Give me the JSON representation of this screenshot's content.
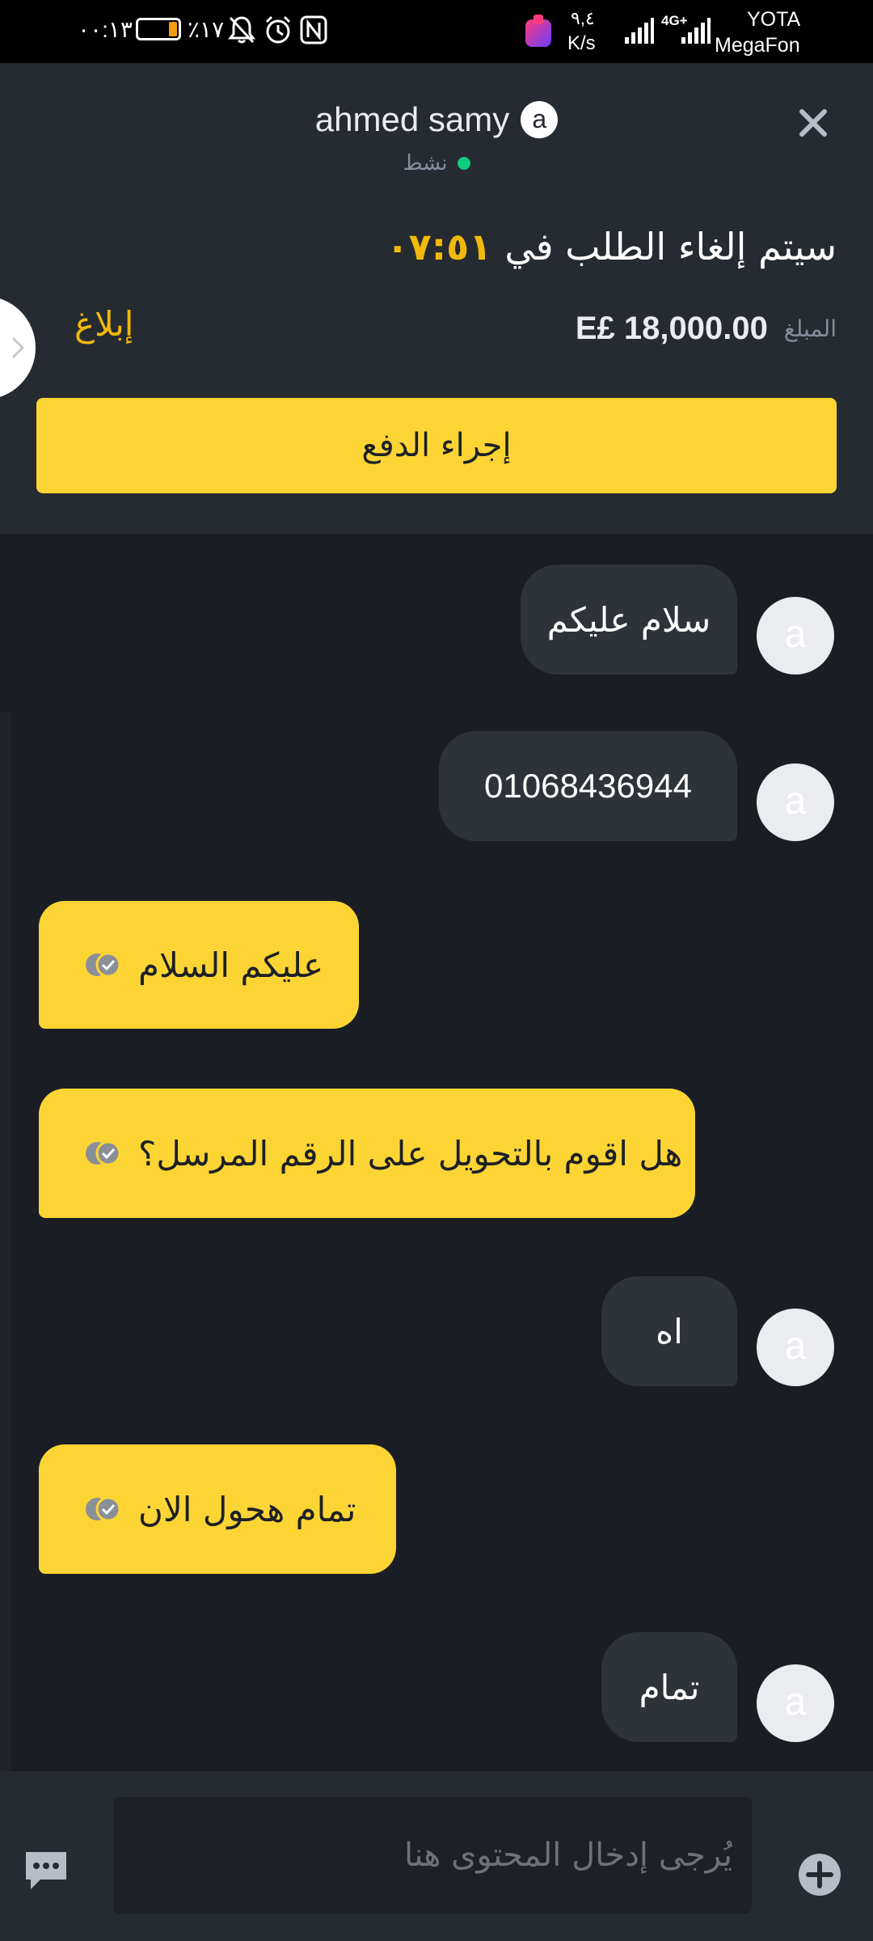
{
  "status_bar": {
    "time": "٠٠:١٣",
    "battery": "٪١٧",
    "speed_value": "٩,٤",
    "speed_unit": "K/s",
    "network": "4G+",
    "carrier_1": "YOTA",
    "carrier_2": "MegaFon"
  },
  "header": {
    "contact_name": "ahmed samy",
    "contact_initial": "a",
    "status_text": "نشط",
    "status_color": "#0ecb81",
    "cancel_text": "سيتم إلغاء الطلب في",
    "countdown": "٠٧:٥١",
    "amount_label": "المبلغ",
    "amount_value": "E£ 18,000.00",
    "report_label": "إبلاغ",
    "pay_button": "إجراء الدفع",
    "accent_color": "#fcd535"
  },
  "messages": [
    {
      "from": "them",
      "text": "سلام عليكم",
      "initial": "a"
    },
    {
      "from": "them",
      "text": "01068436944",
      "initial": "a"
    },
    {
      "from": "me",
      "text": "عليكم السلام",
      "read": true
    },
    {
      "from": "me",
      "text": "هل اقوم بالتحويل على الرقم المرسل؟",
      "read": true
    },
    {
      "from": "them",
      "text": "اه",
      "initial": "a"
    },
    {
      "from": "me",
      "text": "تمام هحول الان",
      "read": true
    },
    {
      "from": "them",
      "text": "تمام",
      "initial": "a"
    }
  ],
  "input": {
    "placeholder": "يُرجى إدخال المحتوى هنا",
    "value": ""
  }
}
